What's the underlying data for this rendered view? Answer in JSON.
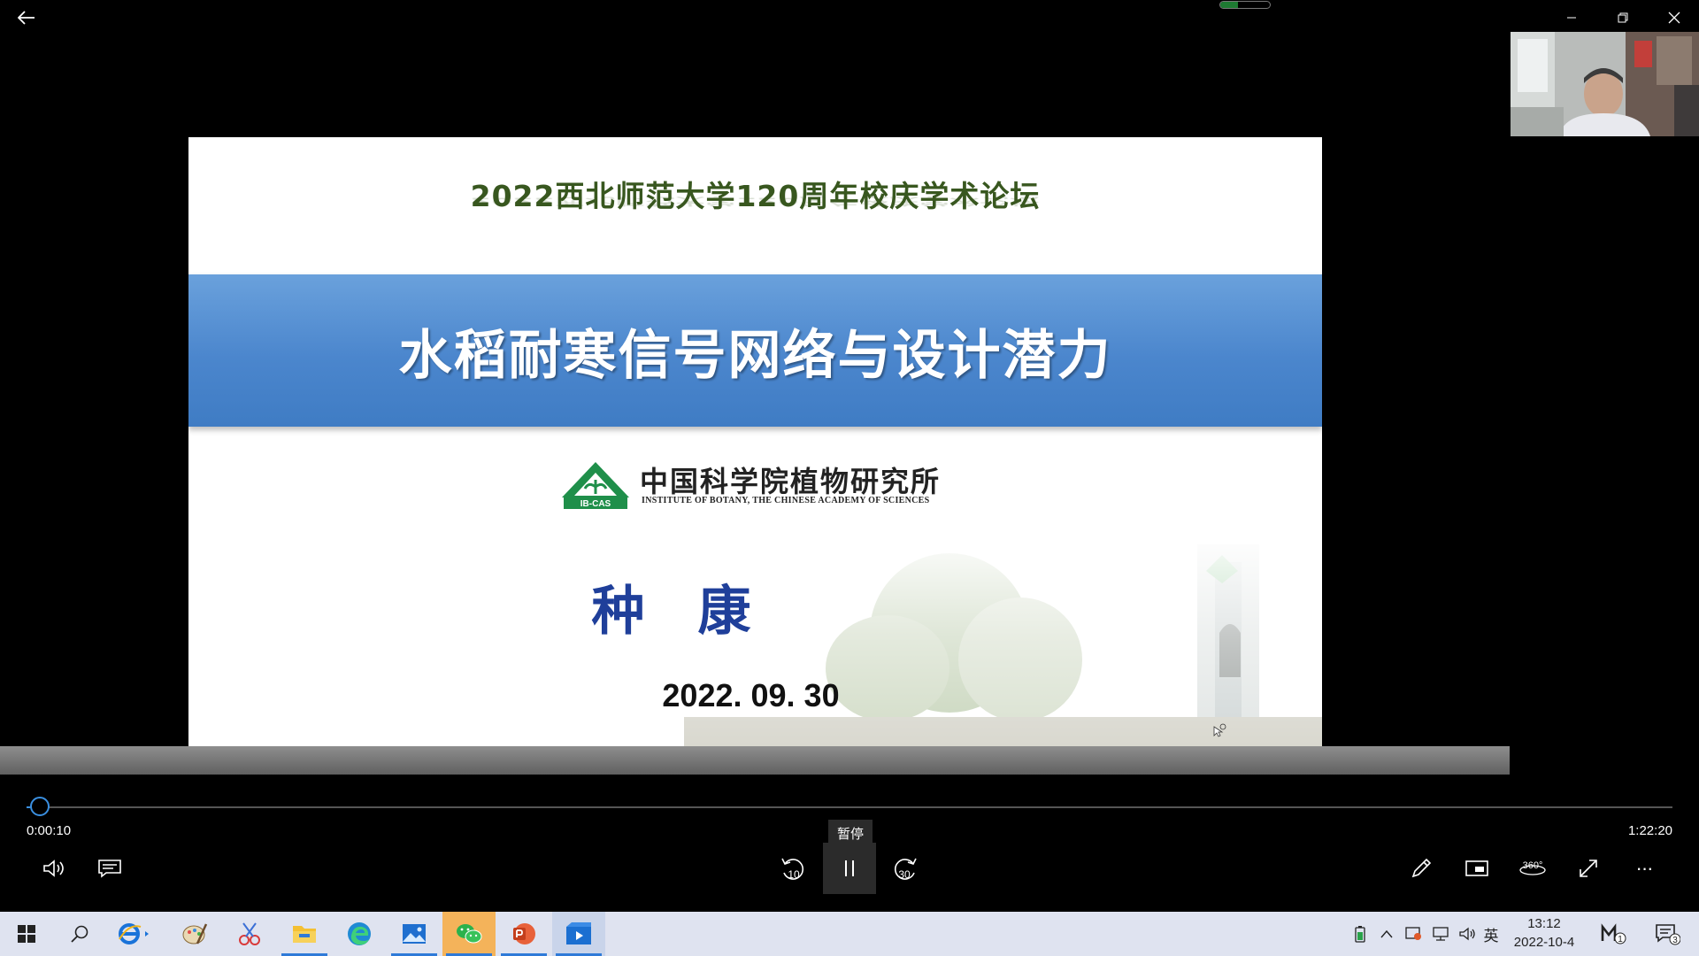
{
  "window": {
    "back_label": "back",
    "minimize": "minimize",
    "restore": "restore",
    "close": "close"
  },
  "top_indicator": {
    "level": 0.35,
    "color": "#1e7a32"
  },
  "slide": {
    "conference_title": "2022西北师范大学120周年校庆学术论坛",
    "talk_title": "水稻耐寒信号网络与设计潜力",
    "institute_cn": "中国科学院植物研究所",
    "institute_en": "INSTITUTE OF BOTANY, THE CHINESE ACADEMY OF SCIENCES",
    "logo_text": "IB-CAS",
    "author": "种康",
    "date": "2022. 09. 30",
    "banner_color": "#4b86cd",
    "title_color": "#38571f",
    "author_color": "#1f3f9a"
  },
  "player": {
    "current_time": "0:00:10",
    "total_time": "1:22:20",
    "progress": 0.002,
    "pause_tooltip": "暂停",
    "rewind_seconds": "10",
    "forward_seconds": "30",
    "accent_color": "#3a8fe0",
    "left_controls": [
      "volume-icon",
      "captions-icon"
    ],
    "right_controls": [
      "pen-icon",
      "mini-view-icon",
      "360-icon",
      "fullscreen-icon",
      "more-icon"
    ],
    "view_360_label": "360°",
    "more_label": "···"
  },
  "taskbar": {
    "apps": [
      "start-icon",
      "search-icon",
      "ie-icon",
      "paint-icon",
      "snip-icon",
      "file-explorer-icon",
      "edge-icon",
      "photos-icon",
      "wechat-icon",
      "powerpoint-icon",
      "movies-tv-icon"
    ],
    "tray": {
      "ime_label": "英",
      "time": "13:12",
      "date": "2022-10-4",
      "notification_count": "3",
      "m_badge": "1"
    }
  }
}
